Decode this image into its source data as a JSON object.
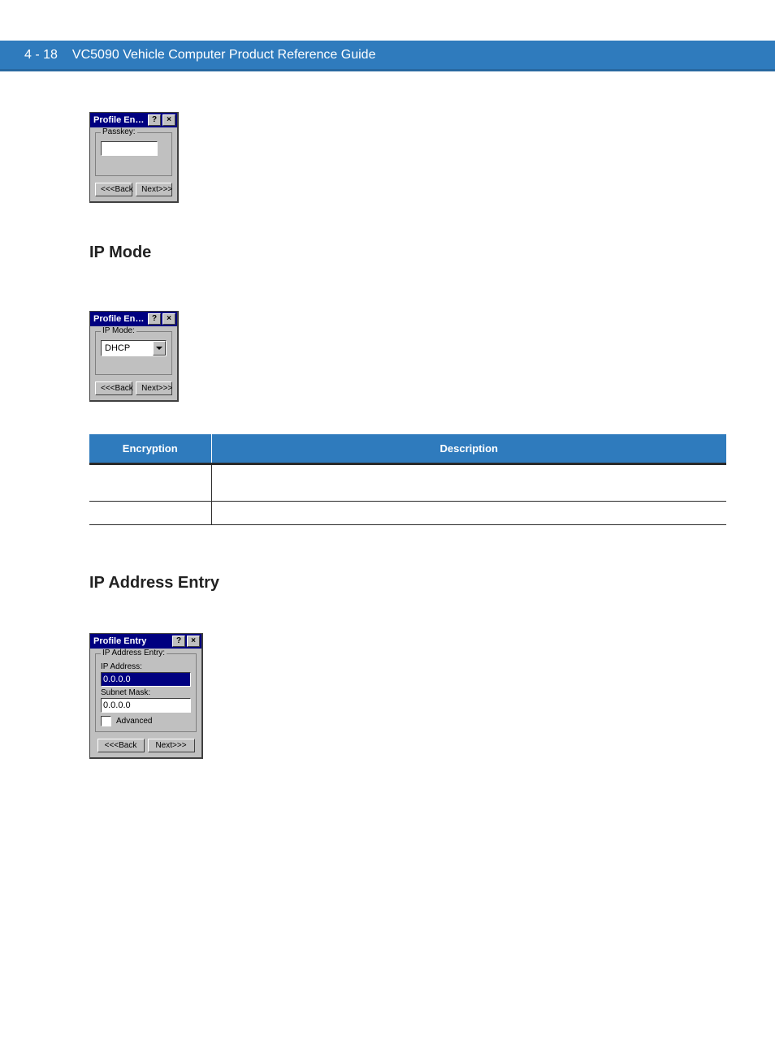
{
  "header": {
    "page_number": "4 - 18",
    "title": "VC5090 Vehicle Computer Product Reference Guide"
  },
  "sections": {
    "ip_mode_heading": "IP Mode",
    "ip_address_heading": "IP Address Entry"
  },
  "dialog1": {
    "title": "Profile En…",
    "help": "?",
    "close": "×",
    "group_legend": "Passkey:",
    "passkey_value": "",
    "back": "<<<Back",
    "next": "Next>>>"
  },
  "dialog2": {
    "title": "Profile En…",
    "help": "?",
    "close": "×",
    "group_legend": "IP Mode:",
    "select_value": "DHCP",
    "back": "<<<Back",
    "next": "Next>>>"
  },
  "dialog3": {
    "title": "Profile Entry",
    "help": "?",
    "close": "×",
    "group_legend": "IP Address Entry:",
    "ip_label": "IP Address:",
    "ip_value": "0.0.0.0",
    "subnet_label": "Subnet Mask:",
    "subnet_value": "0.0.0.0",
    "advanced_label": "Advanced",
    "back": "<<<Back",
    "next": "Next>>>"
  },
  "table": {
    "col1": "Encryption",
    "col2": "Description",
    "rows": [
      {
        "c1": "",
        "c2": ""
      },
      {
        "c1": "",
        "c2": ""
      }
    ]
  }
}
